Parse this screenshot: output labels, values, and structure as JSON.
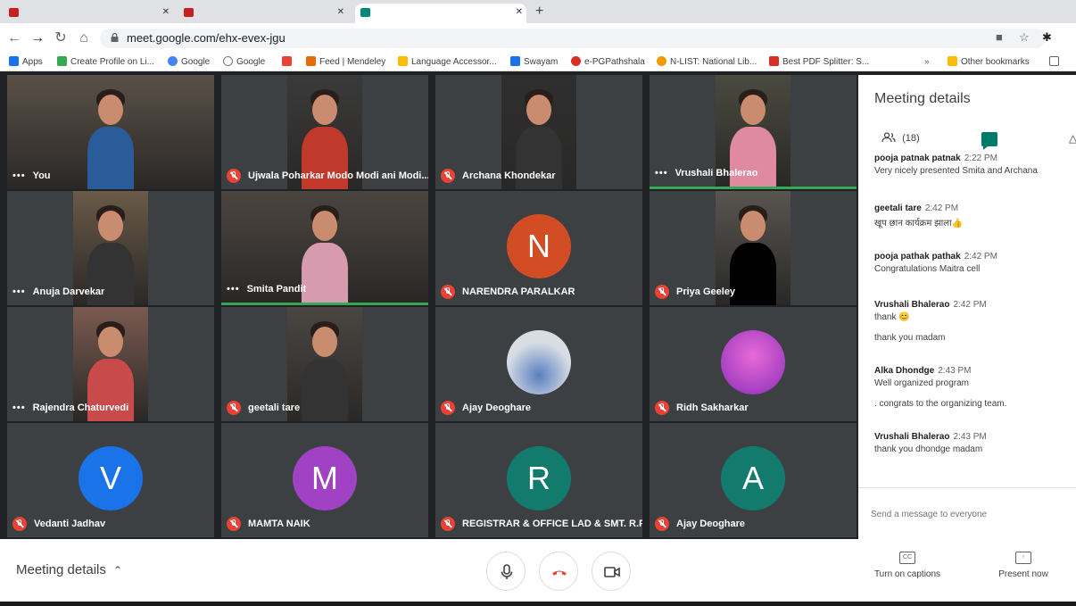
{
  "browser": {
    "url": "meet.google.com/ehx-evex-jgu",
    "bookmarks": [
      "Apps",
      "Create Profile on Li...",
      "Google",
      "Google",
      "Feed | Mendeley",
      "Language Accessor...",
      "Swayam",
      "e-PGPathshala",
      "N-LIST: National Lib...",
      "Best PDF Splitter: S...",
      "Other bookmarks"
    ]
  },
  "colors": {
    "meet_bg": "#202124",
    "tile_bg": "#3c4043",
    "mic_off": "#ea4335",
    "speaking": "#34a853",
    "chat_icon": "#00796b",
    "hangup": "#ea4335"
  },
  "tiles": [
    {
      "name": "You",
      "muted": false,
      "type": "video"
    },
    {
      "name": "Ujwala Poharkar Modo Modi ani Modi...",
      "muted": true,
      "type": "video"
    },
    {
      "name": "Archana Khondekar",
      "muted": true,
      "type": "video"
    },
    {
      "name": "Vrushali Bhalerao",
      "muted": false,
      "type": "video"
    },
    {
      "name": "Anuja Darvekar",
      "muted": false,
      "type": "video"
    },
    {
      "name": "Smita Pandit",
      "muted": false,
      "type": "video"
    },
    {
      "name": "NARENDRA PARALKAR",
      "muted": true,
      "type": "avatar",
      "initial": "N",
      "color": "#d34d24"
    },
    {
      "name": "Priya Geeley",
      "muted": true,
      "type": "video"
    },
    {
      "name": "Rajendra Chaturvedi",
      "muted": false,
      "type": "video"
    },
    {
      "name": "geetali tare",
      "muted": true,
      "type": "video"
    },
    {
      "name": "Ajay Deoghare",
      "muted": true,
      "type": "photo"
    },
    {
      "name": "Ridh Sakharkar",
      "muted": true,
      "type": "photo"
    },
    {
      "name": "Vedanti Jadhav",
      "muted": true,
      "type": "avatar",
      "initial": "V",
      "color": "#1a73e8"
    },
    {
      "name": "MAMTA NAIK",
      "muted": true,
      "type": "avatar",
      "initial": "M",
      "color": "#a142c4"
    },
    {
      "name": "REGISTRAR & OFFICE LAD & SMT. R.P...",
      "muted": true,
      "type": "avatar",
      "initial": "R",
      "color": "#137b6d"
    },
    {
      "name": "Ajay Deoghare",
      "muted": true,
      "type": "avatar",
      "initial": "A",
      "color": "#137b6d"
    }
  ],
  "panel": {
    "title": "Meeting details",
    "people_count": "(18)",
    "messages": [
      {
        "sender": "pooja patnak patnak",
        "time": "2:22 PM",
        "lines": [
          "Very nicely presented Smita and Archana"
        ]
      },
      {
        "sender": "geetali tare",
        "time": "2:42 PM",
        "lines": [
          "खूप छान कार्यक्रम झाला👍"
        ]
      },
      {
        "sender": "pooja pathak pathak",
        "time": "2:42 PM",
        "lines": [
          "Congratulations Maitra cell"
        ]
      },
      {
        "sender": "Vrushali Bhalerao",
        "time": "2:42 PM",
        "lines": [
          "thank 😊",
          "thank you madam"
        ]
      },
      {
        "sender": "Alka Dhondge",
        "time": "2:43 PM",
        "lines": [
          "Well organized program",
          ". congrats to the organizing team."
        ]
      },
      {
        "sender": "Vrushali Bhalerao",
        "time": "2:43 PM",
        "lines": [
          "thank you dhondge madam"
        ]
      }
    ],
    "send_placeholder": "Send a message to everyone"
  },
  "bottom": {
    "details_label": "Meeting details",
    "captions_label": "Turn on captions",
    "present_label": "Present now"
  }
}
